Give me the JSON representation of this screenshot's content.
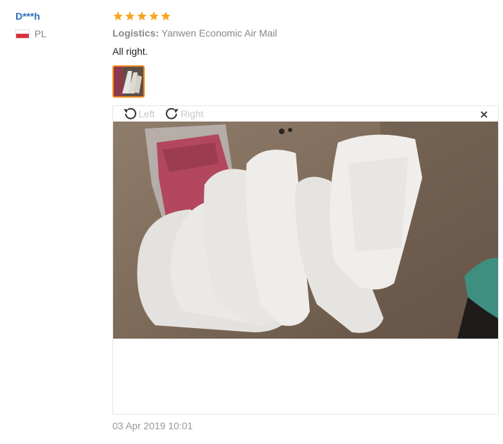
{
  "user": {
    "name": "D***h",
    "country": "PL"
  },
  "review": {
    "rating": 5,
    "logistics_label": "Logistics:",
    "logistics_value": "Yanwen Economic Air Mail",
    "feedback": "All right.",
    "date": "03 Apr 2019 10:01"
  },
  "viewer": {
    "rotate_left_label": "Left",
    "rotate_right_label": "Right",
    "close_icon": "close-icon"
  },
  "colors": {
    "user_name": "#2a6ebb",
    "star": "#f5a623",
    "thumb_border": "#f48a1f",
    "muted": "#888888"
  }
}
